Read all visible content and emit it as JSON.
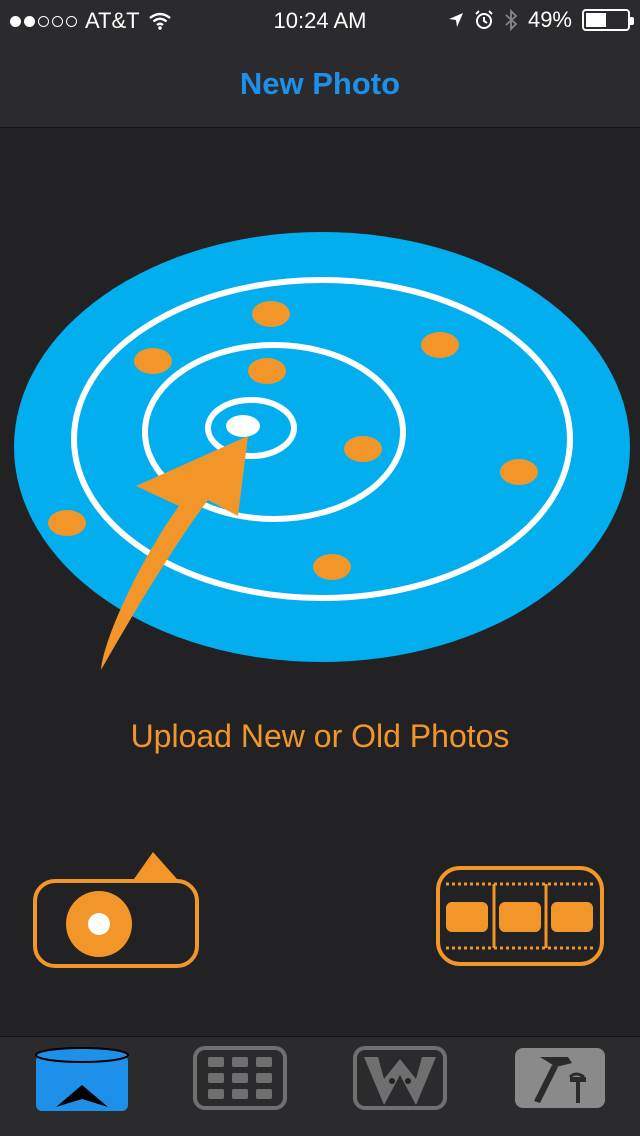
{
  "status": {
    "carrier": "AT&T",
    "time": "10:24 AM",
    "battery_text": "49%",
    "battery_level": 0.49,
    "signal_bars_filled": 2,
    "signal_bars_total": 5
  },
  "nav": {
    "title": "New Photo"
  },
  "main": {
    "upload_text": "Upload New or Old Photos"
  },
  "actions": {
    "camera_icon": "camera-icon",
    "film_icon": "film-strip-icon"
  },
  "tabs": [
    {
      "icon": "new-photo-tab-icon",
      "selected": true
    },
    {
      "icon": "grid-tab-icon",
      "selected": false
    },
    {
      "icon": "w-app-tab-icon",
      "selected": false
    },
    {
      "icon": "tools-tab-icon",
      "selected": false
    }
  ],
  "colors": {
    "accent_blue": "#1e90ea",
    "radar_blue": "#03aeef",
    "orange": "#f3962a",
    "background": "#222224",
    "bar": "#2b2b2d"
  }
}
